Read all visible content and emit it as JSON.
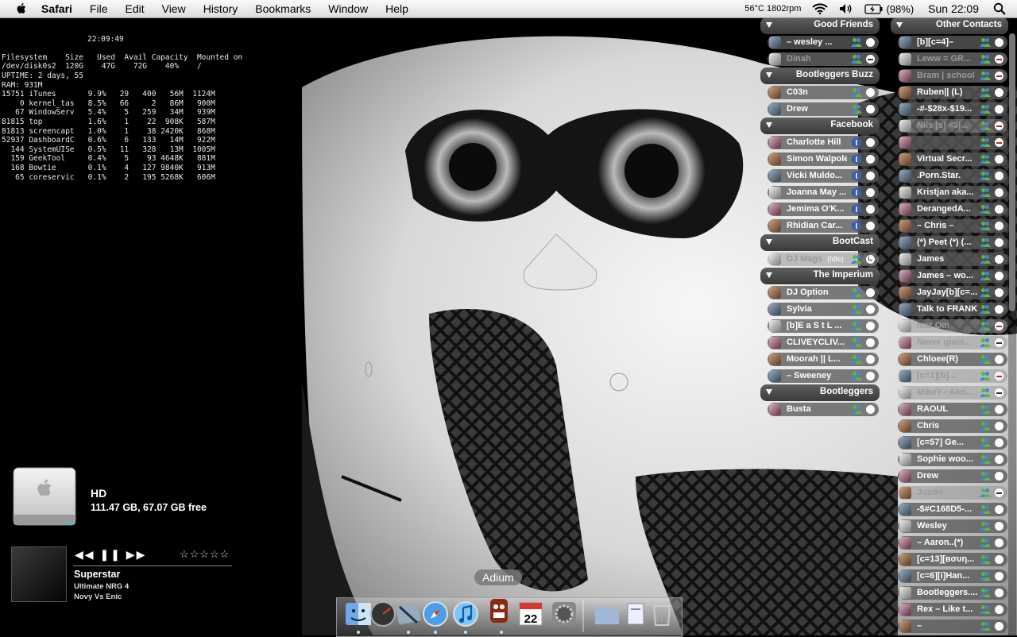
{
  "menubar": {
    "app": "Safari",
    "items": [
      "File",
      "Edit",
      "View",
      "History",
      "Bookmarks",
      "Window",
      "Help"
    ],
    "temp_fan": "56°C 1802rpm",
    "battery": "(98%)",
    "clock": "Sun 22:09"
  },
  "geektool": {
    "time": "22:09:49",
    "lines": [
      "Filesystem    Size   Used  Avail Capacity  Mounted on",
      "/dev/disk0s2  120G    47G    72G    40%    /",
      "UPTIME: 2 days, 55",
      "RAM: 931M",
      "15751 iTunes       9.9%   29   400   56M  1124M",
      "    0 kernel_tas   8.5%   66     2   86M   900M",
      "   67 WindowServ   5.4%    5   259   34M   939M",
      "81815 top          1.6%    1    22  908K   587M",
      "81813 screencapt   1.0%    1    38 2420K   868M",
      "52937 DashboardC   0.6%    6   133   14M   922M",
      "  144 SystemUISe   0.5%   11   328   13M  1005M",
      "  159 GeekTool     0.4%    5    93 4648K   881M",
      "  168 Bowtie       0.1%    4   127 9840K   913M",
      "   65 coreservic   0.1%    2   195 5268K   606M"
    ]
  },
  "hd": {
    "name": "HD",
    "space": "111.47 GB, 67.07 GB free"
  },
  "bowtie": {
    "controls": "◀◀ ❚❚ ▶▶",
    "rating": "☆☆☆☆☆",
    "track": "Superstar",
    "album": "Ultimate NRG 4",
    "artist": "Novy Vs Enic"
  },
  "adium": {
    "col1": [
      {
        "group": "Good Friends"
      },
      {
        "name": "– wesley ...",
        "svc": "msn",
        "status": "available"
      },
      {
        "name": "Dinah",
        "svc": "msn",
        "status": "away",
        "idle": true
      },
      {
        "group": "Bootleggers Buzz"
      },
      {
        "name": "C03n",
        "svc": "msn",
        "status": "available"
      },
      {
        "name": "Drew",
        "svc": "msn",
        "status": "available"
      },
      {
        "group": "Facebook"
      },
      {
        "name": "Charlotte Hill",
        "svc": "fb",
        "status": "available"
      },
      {
        "name": "Simon Walpole",
        "svc": "fb",
        "status": "available"
      },
      {
        "name": "Vicki Muldo...",
        "svc": "fb",
        "status": "available"
      },
      {
        "name": "Joanna May ...",
        "svc": "fb",
        "status": "available"
      },
      {
        "name": "Jemima O'K...",
        "svc": "fb",
        "status": "available"
      },
      {
        "name": "Rhidian Car...",
        "svc": "fb",
        "status": "available"
      },
      {
        "group": "BootCast"
      },
      {
        "name": "DJ Mags",
        "idle_tag": "(Idle)",
        "svc": "msn",
        "status": "idle",
        "idle": true
      },
      {
        "group": "The Imperium"
      },
      {
        "name": "DJ Option",
        "svc": "msn",
        "status": "available"
      },
      {
        "name": "Sylvia",
        "svc": "msn",
        "status": "available"
      },
      {
        "name": "[b]E a S t  L ...",
        "svc": "msn",
        "status": "available"
      },
      {
        "name": "CLIVEYCLIV...",
        "svc": "msn",
        "status": "available"
      },
      {
        "name": "Moorah || L...",
        "svc": "msn",
        "status": "available"
      },
      {
        "name": "– Sweeney",
        "svc": "msn",
        "status": "available"
      },
      {
        "group": "Bootleggers"
      },
      {
        "name": "Busta",
        "svc": "msn",
        "status": "available"
      }
    ],
    "col2": [
      {
        "group": "Other Contacts"
      },
      {
        "name": "[b][c=4]–",
        "svc": "msn",
        "status": "available"
      },
      {
        "name": "Leww = GR...",
        "svc": "msn",
        "status": "busy",
        "idle": true
      },
      {
        "name": "Bram | school",
        "svc": "msn",
        "status": "busy",
        "idle": true
      },
      {
        "name": "Ruben|| (L)",
        "svc": "msn",
        "status": "available"
      },
      {
        "name": "-#-$28x-$19...",
        "svc": "msn",
        "status": "available"
      },
      {
        "name": "Nils [s] <3|...",
        "svc": "msn",
        "status": "busy",
        "idle": true
      },
      {
        "name": "",
        "svc": "msn",
        "status": "busy"
      },
      {
        "name": "Virtual Secr...",
        "svc": "msn",
        "status": "available"
      },
      {
        "name": ".Porn.Star.",
        "svc": "msn",
        "status": "available"
      },
      {
        "name": "Kristjan aka...",
        "svc": "msn",
        "status": "available"
      },
      {
        "name": "DerangedA...",
        "svc": "msn",
        "status": "available"
      },
      {
        "name": "– Chris –",
        "svc": "msn",
        "status": "available"
      },
      {
        "name": "(*) Peet (*) (...",
        "svc": "msn",
        "status": "available"
      },
      {
        "name": "James",
        "svc": "msn",
        "status": "available"
      },
      {
        "name": "James – wo...",
        "svc": "msn",
        "status": "available"
      },
      {
        "name": "JayJay[b][c=...",
        "svc": "msn",
        "status": "available"
      },
      {
        "name": "Talk to FRANK",
        "svc": "msn",
        "status": "available"
      },
      {
        "name": "Ivar Om",
        "svc": "msn",
        "status": "busy",
        "idle": true
      },
      {
        "name": "Never givin...",
        "svc": "msn",
        "status": "away",
        "idle": true
      },
      {
        "name": "Chloee(R)",
        "svc": "msn",
        "status": "available"
      },
      {
        "name": "[c=1][b]...",
        "svc": "msn",
        "status": "busy",
        "idle": true
      },
      {
        "name": "MikeY– Alm...",
        "svc": "msn",
        "status": "away",
        "idle": true
      },
      {
        "name": "RAOUL",
        "svc": "msn",
        "status": "available"
      },
      {
        "name": "Chris",
        "svc": "msn",
        "status": "available"
      },
      {
        "name": "[c=57]  Ge...",
        "svc": "msn",
        "status": "available"
      },
      {
        "name": "Sophie woo...",
        "svc": "msn",
        "status": "available"
      },
      {
        "name": "Drew",
        "svc": "msn",
        "status": "available"
      },
      {
        "name": "Justin",
        "svc": "msn",
        "status": "away",
        "idle": true
      },
      {
        "name": "-$#C168D5-...",
        "svc": "msn",
        "status": "available"
      },
      {
        "name": "Wesley",
        "svc": "msn",
        "status": "available"
      },
      {
        "name": "– Aaron..(*)",
        "svc": "msn",
        "status": "available"
      },
      {
        "name": "[c=13][вσυη...",
        "svc": "msn",
        "status": "available"
      },
      {
        "name": "[c=6][i]Han...",
        "svc": "msn",
        "status": "available"
      },
      {
        "name": "Bootleggers....",
        "svc": "msn",
        "status": "available"
      },
      {
        "name": "Rex – Like t...",
        "svc": "msn",
        "status": "available"
      },
      {
        "name": "–",
        "svc": "msn",
        "status": "available"
      }
    ]
  },
  "dock": {
    "tooltip": "Adium",
    "items": [
      {
        "name": "finder",
        "running": true
      },
      {
        "name": "activity",
        "running": false
      },
      {
        "name": "mail",
        "running": true
      },
      {
        "name": "safari",
        "running": true
      },
      {
        "name": "itunes",
        "running": true
      },
      {
        "name": "adium",
        "running": true
      },
      {
        "name": "ical",
        "running": false,
        "date": "22",
        "month": "MAR"
      },
      {
        "name": "system-preferences",
        "running": false
      },
      {
        "name": "applications-folder",
        "running": false
      },
      {
        "name": "documents",
        "running": false
      },
      {
        "name": "trash",
        "running": false
      }
    ]
  },
  "colors": {
    "accent": "#3b5ca8",
    "busy": "#c22222"
  }
}
